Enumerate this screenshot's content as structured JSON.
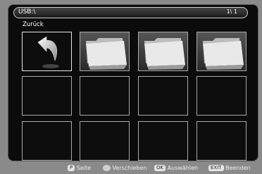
{
  "header": {
    "path": "USB:\\",
    "page_indicator": "1\\ 1",
    "back_label": "Zurück"
  },
  "grid": {
    "tiles": [
      {
        "type": "back-arrow-icon"
      },
      {
        "type": "folder-icon"
      },
      {
        "type": "folder-icon"
      },
      {
        "type": "folder-icon"
      },
      {
        "type": "empty"
      },
      {
        "type": "empty"
      },
      {
        "type": "empty"
      },
      {
        "type": "empty"
      },
      {
        "type": "empty"
      },
      {
        "type": "empty"
      },
      {
        "type": "empty"
      },
      {
        "type": "empty"
      }
    ]
  },
  "footer": {
    "page_key": "P",
    "page_label": "Seite",
    "move_label": "Verschieben",
    "ok_key": "OK",
    "select_label": "Auswählen",
    "exit_key": "EXIT",
    "exit_label": "Beenden"
  }
}
